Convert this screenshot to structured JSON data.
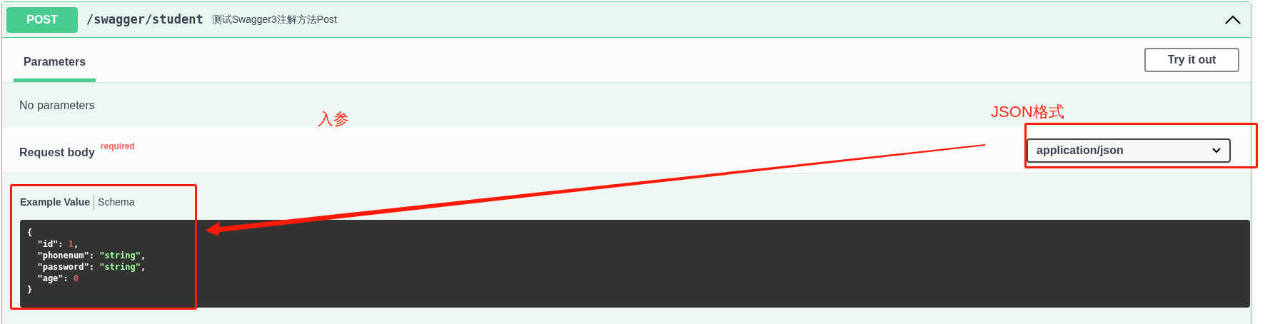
{
  "operation": {
    "method": "POST",
    "path": "/swagger/student",
    "summary": "测试Swagger3注解方法Post",
    "expanded": true
  },
  "tabs": [
    {
      "label": "Parameters",
      "selected": true
    }
  ],
  "try_button": "Try it out",
  "no_params": "No parameters",
  "request_body": {
    "title": "Request body",
    "required_label": "required",
    "content_type": "application/json"
  },
  "example_tabs": [
    {
      "label": "Example Value",
      "selected": true
    },
    {
      "label": "Schema",
      "selected": false
    }
  ],
  "code_lines": [
    [
      {
        "kind": "punct",
        "text": "{"
      }
    ],
    [
      {
        "kind": "key",
        "text": "  \"id\""
      },
      {
        "kind": "punct",
        "text": ": "
      },
      {
        "kind": "number",
        "text": "1"
      },
      {
        "kind": "punct",
        "text": ","
      }
    ],
    [
      {
        "kind": "key",
        "text": "  \"phonenum\""
      },
      {
        "kind": "punct",
        "text": ": "
      },
      {
        "kind": "string",
        "text": "\"string\""
      },
      {
        "kind": "punct",
        "text": ","
      }
    ],
    [
      {
        "kind": "key",
        "text": "  \"password\""
      },
      {
        "kind": "punct",
        "text": ": "
      },
      {
        "kind": "string",
        "text": "\"string\""
      },
      {
        "kind": "punct",
        "text": ","
      }
    ],
    [
      {
        "kind": "key",
        "text": "  \"age\""
      },
      {
        "kind": "punct",
        "text": ": "
      },
      {
        "kind": "number",
        "text": "0"
      }
    ],
    [
      {
        "kind": "punct",
        "text": "}"
      }
    ]
  ],
  "annotations": [
    {
      "kind": "text",
      "text": "入参"
    },
    {
      "kind": "text",
      "text": "JSON格式"
    },
    {
      "kind": "box"
    },
    {
      "kind": "box"
    },
    {
      "kind": "arrow"
    }
  ]
}
